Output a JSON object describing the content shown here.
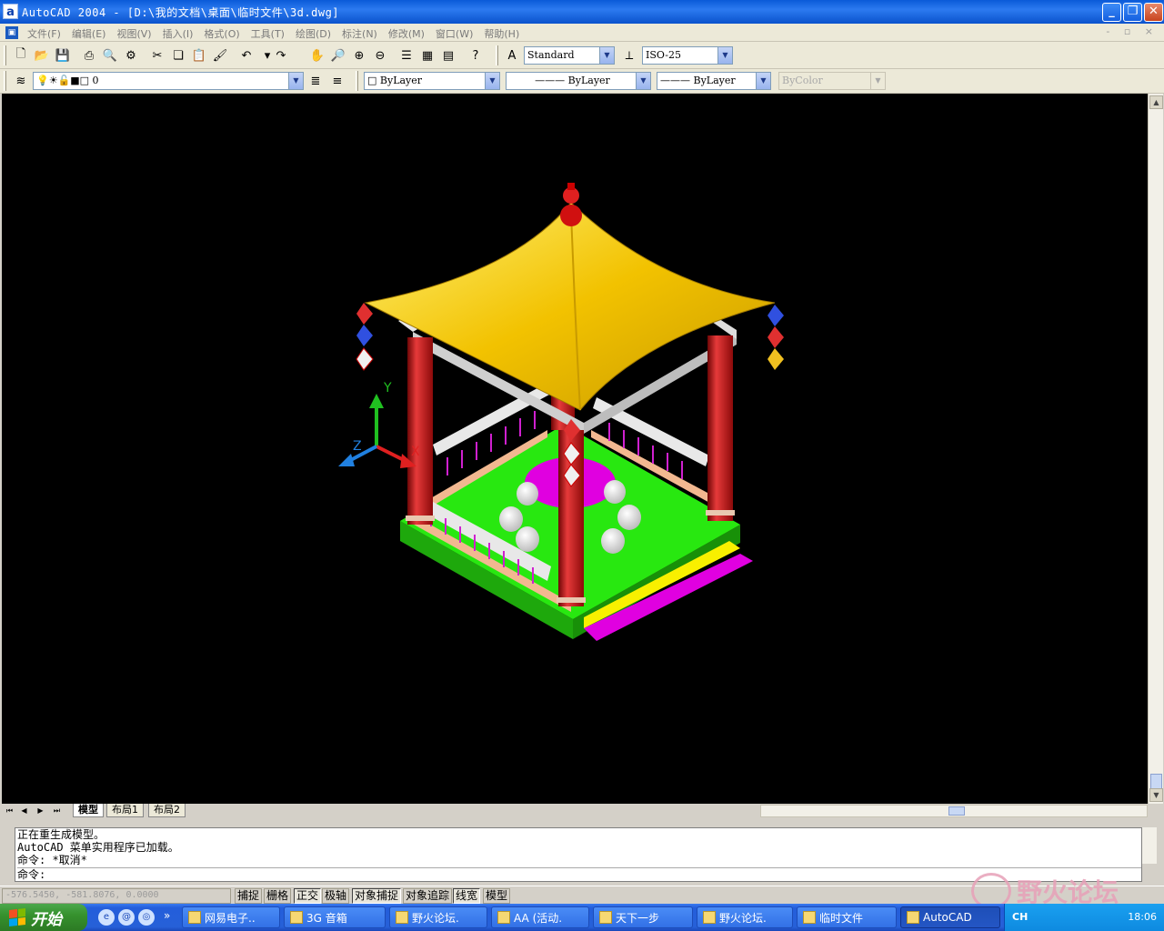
{
  "window": {
    "app_icon": "a",
    "title": "AutoCAD 2004 - [D:\\我的文档\\桌面\\临时文件\\3d.dwg]",
    "minimize_label": "_",
    "restore_label": "❐",
    "close_label": "✕"
  },
  "menu": {
    "items": [
      "文件(F)",
      "编辑(E)",
      "视图(V)",
      "插入(I)",
      "格式(O)",
      "工具(T)",
      "绘图(D)",
      "标注(N)",
      "修改(M)",
      "窗口(W)",
      "帮助(H)"
    ],
    "right_controls": "- ▫ ×"
  },
  "toolbar1": {
    "text_style": "Standard",
    "dim_style": "ISO-25"
  },
  "toolbar2": {
    "layer": "0",
    "color": "ByLayer",
    "linetype": "ByLayer",
    "lineweight": "ByLayer",
    "plotstyle": "ByColor"
  },
  "tabs": {
    "model": "模型",
    "layout1": "布局1",
    "layout2": "布局2"
  },
  "command": {
    "lines": [
      "正在重生成模型。",
      "AutoCAD 菜单实用程序已加载。",
      "命令: *取消*"
    ],
    "prompt": "命令:"
  },
  "status": {
    "coords": "-576.5450, -581.8076, 0.0000",
    "buttons": [
      {
        "label": "捕捉",
        "on": false
      },
      {
        "label": "栅格",
        "on": false
      },
      {
        "label": "正交",
        "on": true
      },
      {
        "label": "极轴",
        "on": false
      },
      {
        "label": "对象捕捉",
        "on": true
      },
      {
        "label": "对象追踪",
        "on": false
      },
      {
        "label": "线宽",
        "on": true
      },
      {
        "label": "模型",
        "on": false
      }
    ]
  },
  "taskbar": {
    "start": "开始",
    "tasks": [
      "网易电子..",
      "3G 音箱",
      "野火论坛.",
      "AA (活动.",
      "天下一步",
      "野火论坛.",
      "临时文件",
      "AutoCAD"
    ],
    "lang": "CH",
    "time": "18:06"
  },
  "ucs": {
    "y": "Y",
    "x": "X",
    "z": "Z"
  },
  "watermark": "野火论坛",
  "colors": {
    "roof": "#f2c200",
    "pillar": "#c81818",
    "floor": "#28e810",
    "table": "#e000e0",
    "step_yellow": "#f8f000",
    "beam": "#e8e8e8",
    "skirting": "#f2b890"
  }
}
